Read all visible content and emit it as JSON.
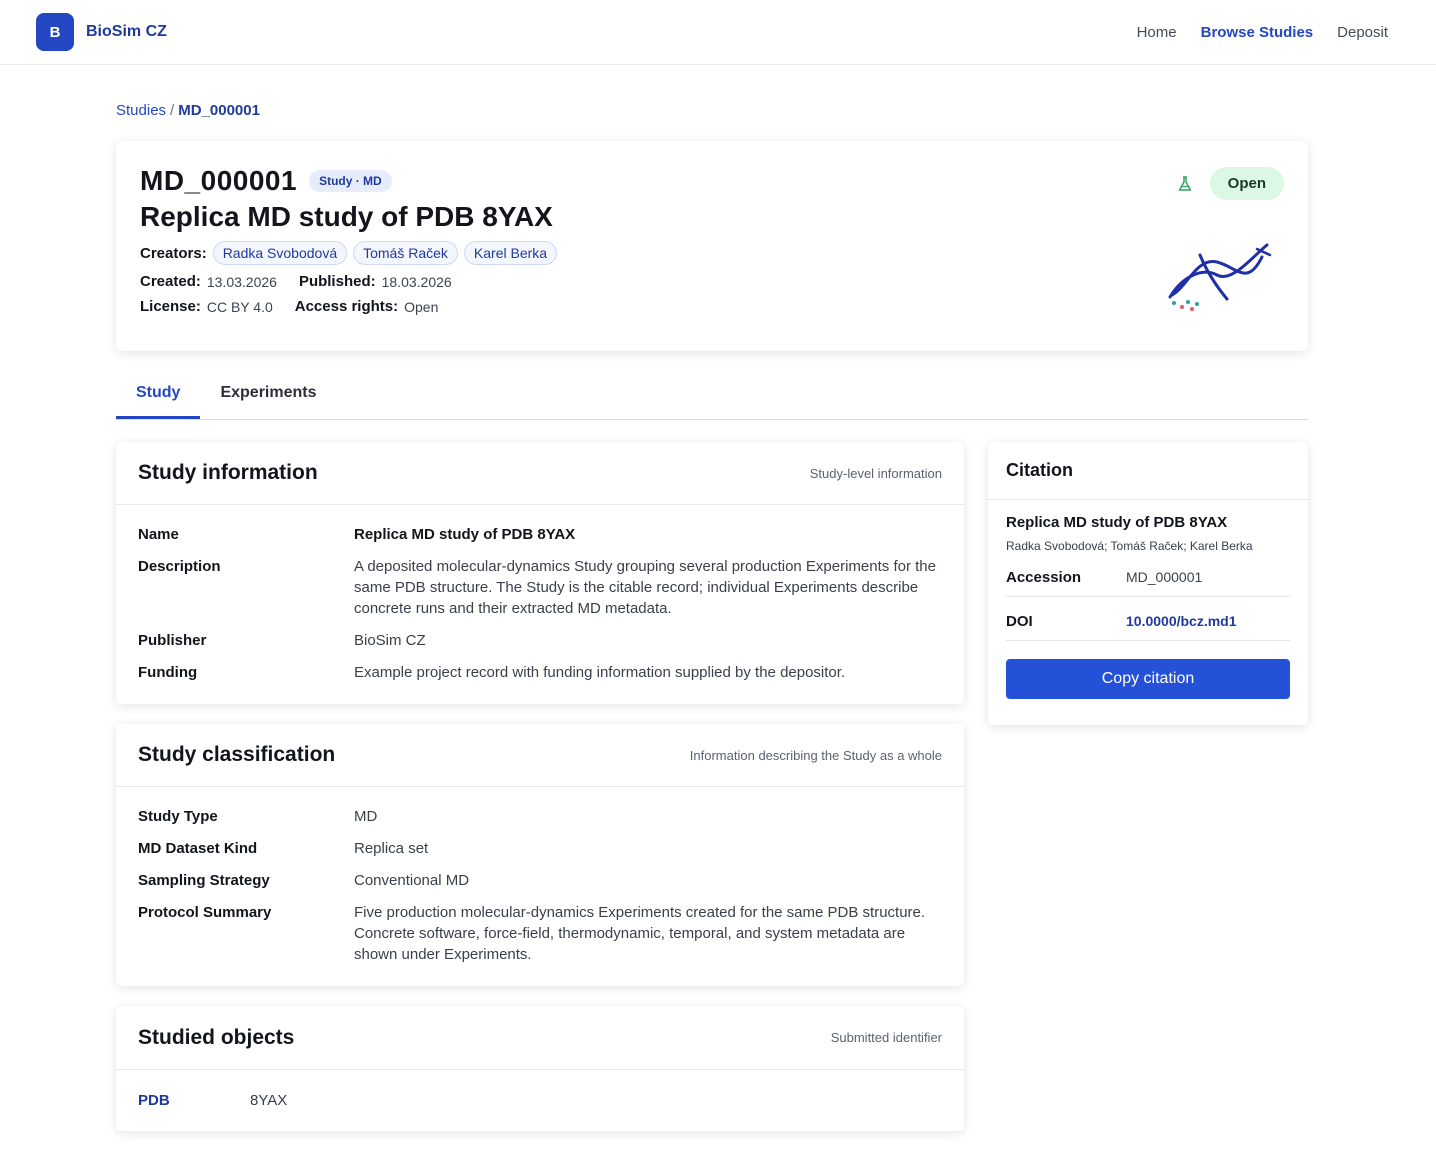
{
  "brand": {
    "logo_letter": "B",
    "name": "BioSim CZ"
  },
  "nav": {
    "home": "Home",
    "browse": "Browse Studies",
    "deposit": "Deposit"
  },
  "breadcrumb": {
    "root": "Studies",
    "sep": "/",
    "current": "MD_000001"
  },
  "header": {
    "accession": "MD_000001",
    "type_badge": "Study · MD",
    "title": "Replica MD study of PDB 8YAX",
    "creators_label": "Creators:",
    "creators": [
      "Radka Svobodová",
      "Tomáš Raček",
      "Karel Berka"
    ],
    "created_label": "Created:",
    "created": "13.03.2026",
    "published_label": "Published:",
    "published": "18.03.2026",
    "license_label": "License:",
    "license": "CC BY 4.0",
    "access_label": "Access rights:",
    "access": "Open",
    "status": "Open"
  },
  "tabs": [
    "Study",
    "Experiments"
  ],
  "study_info": {
    "title": "Study information",
    "subtitle": "Study-level information",
    "rows": [
      {
        "k": "Name",
        "v": "Replica MD study of PDB 8YAX"
      },
      {
        "k": "Description",
        "v": "A deposited molecular-dynamics Study grouping several production Experiments for the same PDB structure. The Study is the citable record; individual Experiments describe concrete runs and their extracted MD metadata."
      },
      {
        "k": "Publisher",
        "v": "BioSim CZ"
      },
      {
        "k": "Funding",
        "v": "Example project record with funding information supplied by the depositor."
      }
    ]
  },
  "classification": {
    "title": "Study classification",
    "subtitle": "Information describing the Study as a whole",
    "rows": [
      {
        "k": "Study Type",
        "v": "MD"
      },
      {
        "k": "MD Dataset Kind",
        "v": "Replica set"
      },
      {
        "k": "Sampling Strategy",
        "v": "Conventional MD"
      },
      {
        "k": "Protocol Summary",
        "v": "Five production molecular-dynamics Experiments created for the same PDB structure. Concrete software, force-field, thermodynamic, temporal, and system metadata are shown under Experiments."
      }
    ]
  },
  "objects": {
    "title": "Studied objects",
    "subtitle": "Submitted identifier",
    "key": "PDB",
    "value": "8YAX"
  },
  "citation": {
    "title": "Citation",
    "name": "Replica MD study of PDB 8YAX",
    "authors": "Radka Svobodová; Tomáš Raček; Karel Berka",
    "accession_label": "Accession",
    "accession": "MD_000001",
    "doi_label": "DOI",
    "doi": "10.0000/bcz.md1",
    "copy_label": "Copy citation"
  },
  "colors": {
    "accent": "#2347c2",
    "open_badge_bg": "#dcf7e4",
    "button": "#2451d8"
  },
  "icons": {
    "status": "flask-icon",
    "illustration": "molecule-icon"
  }
}
